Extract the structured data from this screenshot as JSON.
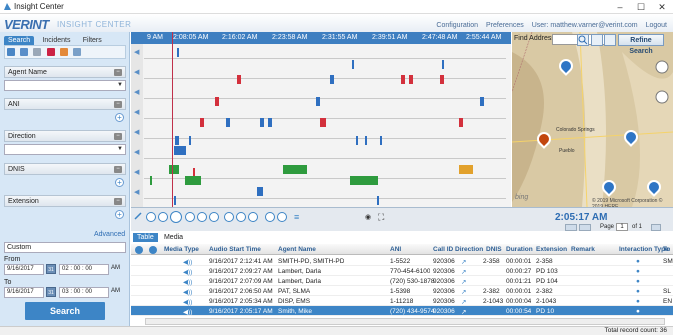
{
  "window": {
    "title": "Insight Center"
  },
  "brand": {
    "name": "VERINT",
    "sub": "INSIGHT CENTER"
  },
  "topnav": {
    "configuration": "Configuration",
    "preferences": "Preferences",
    "user": "User: matthew.varner@verint.com",
    "logout": "Logout"
  },
  "left": {
    "tabs": [
      "Search",
      "Incidents",
      "Filters"
    ],
    "filters": [
      {
        "label": "Agent Name",
        "control": "dropdown"
      },
      {
        "label": "ANI",
        "control": "plus"
      },
      {
        "label": "Direction",
        "control": "dropdown"
      },
      {
        "label": "DNIS",
        "control": "plus"
      },
      {
        "label": "Extension",
        "control": "plus"
      }
    ],
    "advanced": "Advanced",
    "custom": "Custom",
    "from_label": "From",
    "from_date": "9/16/2017",
    "from_time": "02 : 00 : 00",
    "from_ampm": "AM",
    "to_label": "To",
    "to_date": "9/16/2017",
    "to_time": "03 : 00 : 00",
    "to_ampm": "AM",
    "search_label": "Search"
  },
  "timeline": {
    "ticks": [
      "2:08:05 AM",
      "2:16:02 AM",
      "2:23:58 AM",
      "2:31:55 AM",
      "2:39:51 AM",
      "2:47:48 AM",
      "2:55:44 AM"
    ],
    "first_tick_partial": "9 AM"
  },
  "map": {
    "find_label": "Find Address",
    "refine_label": "Refine Search",
    "copyright": "© 2019 Microsoft Corporation  © 2019 HERE",
    "bing": "bing",
    "places": [
      "Colorado Springs",
      "Pueblo"
    ]
  },
  "controls": {
    "clock": "2:05:17 AM",
    "page_label": "Page",
    "page_num": "1",
    "of_label": "of 1"
  },
  "grid": {
    "tabs": [
      "Table",
      "Media"
    ],
    "columns": [
      "Media Type",
      "Audio Start Time",
      "Agent Name",
      "ANI",
      "Call ID",
      "Direction",
      "DNIS",
      "Duration",
      "Extension",
      "Remark",
      "Interaction Type",
      "To"
    ],
    "rows": [
      {
        "start": "9/16/2017 2:12:41 AM",
        "agent": "SMITH-PD, SMITH-PD",
        "ani": "1-5522",
        "callid": "920306",
        "dnis": "2-358",
        "duration": "00:00:01",
        "ext": "2-358",
        "to": "SM"
      },
      {
        "start": "9/16/2017 2:09:27 AM",
        "agent": "Lambert, Darla",
        "ani": "770-454-6100",
        "callid": "920306",
        "dnis": "",
        "duration": "00:00:27",
        "ext": "PD 103",
        "to": ""
      },
      {
        "start": "9/16/2017 2:07:09 AM",
        "agent": "Lambert, Darla",
        "ani": "(720) 530-1878",
        "callid": "920306",
        "dnis": "",
        "duration": "00:01:21",
        "ext": "PD 104",
        "to": ""
      },
      {
        "start": "9/16/2017 2:06:50 AM",
        "agent": "PAT, SLMA",
        "ani": "1-5398",
        "callid": "920306",
        "dnis": "2-382",
        "duration": "00:00:01",
        "ext": "2-382",
        "to": "SL"
      },
      {
        "start": "9/16/2017 2:05:34 AM",
        "agent": "DISP, EMS",
        "ani": "1-11218",
        "callid": "920306",
        "dnis": "2-1043",
        "duration": "00:00:04",
        "ext": "2-1043",
        "to": "EN"
      },
      {
        "start": "9/16/2017 2:05:17 AM",
        "agent": "Smith, Mike",
        "ani": "(720) 434-9574",
        "callid": "920306",
        "dnis": "",
        "duration": "00:00:54",
        "ext": "PD 10",
        "to": ""
      }
    ],
    "total": "Total record count: 36"
  },
  "colors": {
    "accent": "#3d85c6",
    "timeline_axis": "#3e7fc1",
    "mark_blue": "#2f6fc0",
    "mark_red": "#d3303c",
    "mark_green": "#2e9b3e",
    "mark_orange": "#e2a12c"
  }
}
